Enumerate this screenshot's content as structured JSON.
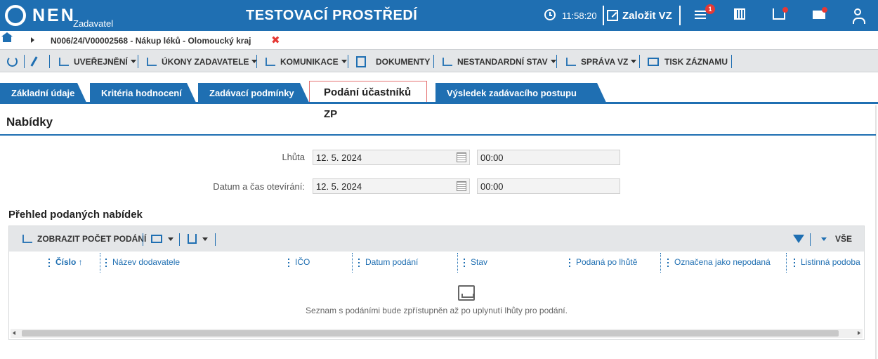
{
  "header": {
    "logo": "NEN",
    "logo_sub": "Zadavatel",
    "env_title": "TESTOVACÍ PROSTŘEDÍ",
    "clock": "11:58:20",
    "new_label": "Založit VZ",
    "notif_count": "1"
  },
  "breadcrumb": {
    "path": "N006/24/V00002568 - Nákup léků - Olomoucký kraj",
    "close": "✖"
  },
  "toolbar": {
    "uverejneni": "UVEŘEJNĚNÍ",
    "ukony": "ÚKONY ZADAVATELE",
    "komunikace": "KOMUNIKACE",
    "dokumenty": "DOKUMENTY",
    "nestandardni": "NESTANDARDNÍ STAV",
    "sprava": "SPRÁVA VZ",
    "tisk": "TISK ZÁZNAMU"
  },
  "tabs": [
    {
      "label": "Základní údaje"
    },
    {
      "label": "Kritéria hodnocení"
    },
    {
      "label": "Zadávací podmínky"
    },
    {
      "label": "Podání účastníků ZP"
    },
    {
      "label": "Výsledek zadávacího postupu"
    }
  ],
  "section": {
    "title": "Nabídky",
    "lhuta_label": "Lhůta",
    "lhuta_date": "12. 5. 2024",
    "lhuta_time": "00:00",
    "open_label": "Datum a čas otevírání:",
    "open_date": "12. 5. 2024",
    "open_time": "00:00"
  },
  "grid": {
    "title": "Přehled podaných nabídek",
    "show_count": "ZOBRAZIT POČET PODÁNÍ",
    "filter_all": "VŠE",
    "columns": [
      "Číslo ↑",
      "Název dodavatele",
      "IČO",
      "Datum podání",
      "Stav",
      "Podaná po lhůtě",
      "Označena jako nepodaná",
      "Listinná podoba"
    ],
    "empty": "Seznam s podáními bude zpřístupněn až po uplynutí lhůty pro podání."
  },
  "colors": {
    "primary": "#1f6fb2",
    "badge": "#e53935"
  }
}
